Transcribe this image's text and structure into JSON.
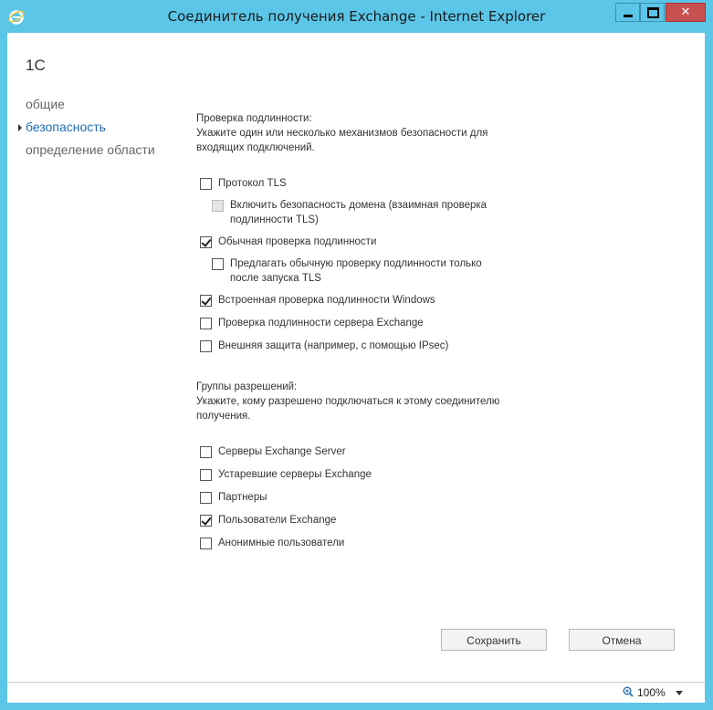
{
  "window": {
    "title": "Соединитель получения Exchange - Internet Explorer",
    "close_glyph": "✕"
  },
  "page": {
    "org_name": "1С"
  },
  "nav": {
    "items": [
      {
        "label": "общие",
        "active": false
      },
      {
        "label": "безопасность",
        "active": true
      },
      {
        "label": "определение области",
        "active": false
      }
    ]
  },
  "auth": {
    "heading": "Проверка подлинности:",
    "description": "Укажите один или несколько механизмов безопасности для входящих подключений.",
    "options": [
      {
        "label": "Протокол TLS",
        "checked": false,
        "disabled": false
      },
      {
        "label": "Включить безопасность домена (взаимная проверка подлинности TLS)",
        "checked": false,
        "disabled": true
      },
      {
        "label": "Обычная проверка подлинности",
        "checked": true,
        "disabled": false
      },
      {
        "label": "Предлагать обычную проверку подлинности только после запуска TLS",
        "checked": false,
        "disabled": false
      },
      {
        "label": "Встроенная проверка подлинности Windows",
        "checked": true,
        "disabled": false
      },
      {
        "label": "Проверка подлинности сервера Exchange",
        "checked": false,
        "disabled": false
      },
      {
        "label": "Внешняя защита (например, с помощью IPsec)",
        "checked": false,
        "disabled": false
      }
    ]
  },
  "permissions": {
    "heading": "Группы разрешений:",
    "description": "Укажите, кому разрешено подключаться к этому соединителю получения.",
    "options": [
      {
        "label": "Серверы Exchange Server",
        "checked": false
      },
      {
        "label": "Устаревшие серверы Exchange",
        "checked": false
      },
      {
        "label": "Партнеры",
        "checked": false
      },
      {
        "label": "Пользователи Exchange",
        "checked": true
      },
      {
        "label": "Анонимные пользователи",
        "checked": false
      }
    ]
  },
  "actions": {
    "save_label": "Сохранить",
    "cancel_label": "Отмена"
  },
  "statusbar": {
    "zoom": "100%"
  },
  "colors": {
    "frame": "#5bc6e8",
    "active_nav": "#1e6db5",
    "close_button": "#c75050"
  }
}
